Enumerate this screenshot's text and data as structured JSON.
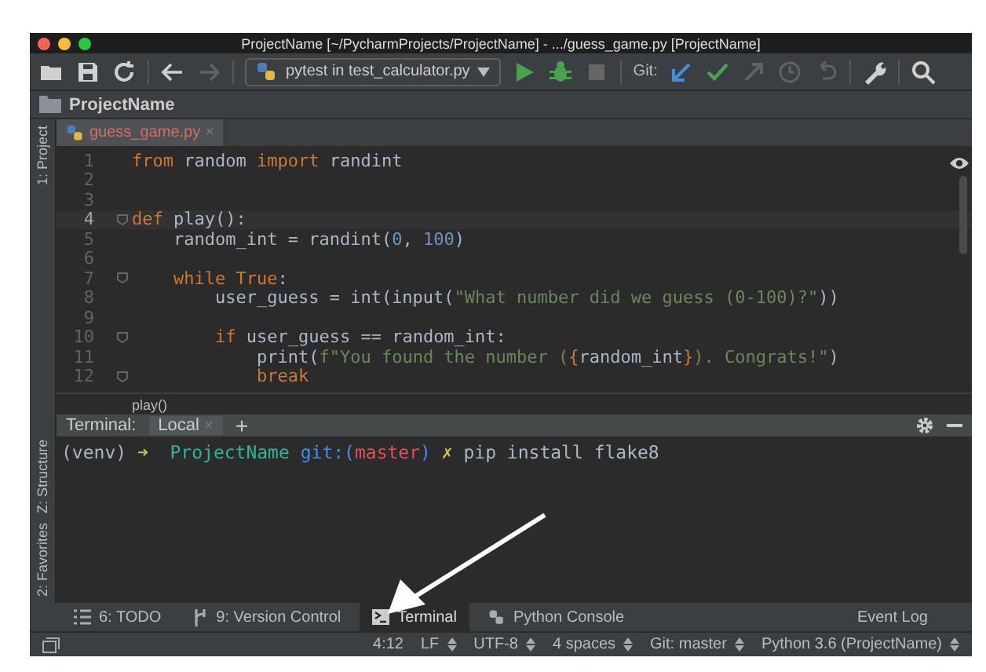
{
  "window": {
    "title": "ProjectName [~/PycharmProjects/ProjectName] - .../guess_game.py [ProjectName]"
  },
  "toolbar": {
    "icons": [
      {
        "disabled": false
      },
      {
        "disabled": false
      },
      {
        "disabled": false
      },
      {
        "disabled": false
      },
      {
        "disabled": true
      }
    ],
    "run_config": "pytest in test_calculator.py",
    "run_icons": [
      {
        "disabled": false
      },
      {
        "disabled": false
      },
      {
        "disabled": true
      }
    ],
    "git_label": "Git:",
    "git_icons": [
      {
        "disabled": false
      },
      {
        "disabled": false
      },
      {
        "disabled": true
      },
      {
        "disabled": true
      },
      {
        "disabled": true
      }
    ]
  },
  "navigation_bar": {
    "project": "ProjectName"
  },
  "left_stripe": [
    "1: Project",
    "Z: Structure",
    "2: Favorites"
  ],
  "editor_tabs": [
    {
      "label": "guess_game.py",
      "selected": true,
      "close": "×"
    }
  ],
  "code_lines": [
    {
      "number": "1",
      "fold": false,
      "current": false,
      "tokens": [
        {
          "kind": "keyword",
          "text": "from"
        },
        {
          "kind": "plain",
          "text": " random "
        },
        {
          "kind": "keyword",
          "text": "import"
        },
        {
          "kind": "plain",
          "text": " randint"
        }
      ]
    },
    {
      "number": "2",
      "fold": false,
      "current": false
    },
    {
      "number": "3",
      "fold": false,
      "current": false
    },
    {
      "number": "4",
      "fold": true,
      "current": true,
      "tokens": [
        {
          "kind": "keyword",
          "text": "def"
        },
        {
          "kind": "plain",
          "text": " play():"
        }
      ]
    },
    {
      "number": "5",
      "fold": false,
      "current": false,
      "tokens": [
        {
          "kind": "plain",
          "text": "    random_int = randint("
        },
        {
          "kind": "number",
          "text": "0"
        },
        {
          "kind": "plain",
          "text": ", "
        },
        {
          "kind": "number",
          "text": "100"
        },
        {
          "kind": "plain",
          "text": ")"
        }
      ]
    },
    {
      "number": "6",
      "fold": false,
      "current": false
    },
    {
      "number": "7",
      "fold": true,
      "current": false,
      "tokens": [
        {
          "kind": "keyword",
          "text": "    while True"
        },
        {
          "kind": "plain",
          "text": ":"
        }
      ]
    },
    {
      "number": "8",
      "fold": false,
      "current": false,
      "tokens": [
        {
          "kind": "plain",
          "text": "        user_guess = int(input("
        },
        {
          "kind": "string",
          "text": "\"What number did we guess (0-100)?\""
        },
        {
          "kind": "plain",
          "text": "))"
        }
      ]
    },
    {
      "number": "9",
      "fold": false,
      "current": false
    },
    {
      "number": "10",
      "fold": true,
      "current": false,
      "tokens": [
        {
          "kind": "keyword",
          "text": "        if"
        },
        {
          "kind": "plain",
          "text": " user_guess == random_int:"
        }
      ]
    },
    {
      "number": "11",
      "fold": false,
      "current": false,
      "tokens": [
        {
          "kind": "plain",
          "text": "            print("
        },
        {
          "kind": "string",
          "text": "f\"You found the number ("
        },
        {
          "kind": "keyword",
          "text": "{"
        },
        {
          "kind": "plain",
          "text": "random_int"
        },
        {
          "kind": "keyword",
          "text": "}"
        },
        {
          "kind": "string",
          "text": "). Congrats!\""
        },
        {
          "kind": "plain",
          "text": ")"
        }
      ]
    },
    {
      "number": "12",
      "fold": true,
      "current": false,
      "tokens": [
        {
          "kind": "keyword",
          "text": "            break"
        }
      ]
    }
  ],
  "breadcrumb": "play()",
  "terminal": {
    "label": "Terminal:",
    "tabs": [
      {
        "label": "Local",
        "selected": true,
        "close": "×"
      }
    ],
    "add": "+",
    "prompt": [
      {
        "kind": "plain",
        "text": "(venv) "
      },
      {
        "kind": "arrow",
        "text": "➜  "
      },
      {
        "kind": "project",
        "text": "ProjectName"
      },
      {
        "kind": "git",
        "text": " git:("
      },
      {
        "kind": "branch",
        "text": "master"
      },
      {
        "kind": "git",
        "text": ") "
      },
      {
        "kind": "dirty",
        "text": "✗"
      },
      {
        "kind": "plain",
        "text": " pip install flake8"
      }
    ]
  },
  "tool_windows": [
    {
      "label": "6: TODO",
      "kind": "list",
      "selected": false
    },
    {
      "label": "9: Version Control",
      "kind": "vcs",
      "selected": false
    },
    {
      "label": "Terminal",
      "kind": "terminal",
      "selected": true
    },
    {
      "label": "Python Console",
      "kind": "python",
      "selected": false
    }
  ],
  "event_log": "Event Log",
  "status_bar": [
    {
      "text": "4:12",
      "dropdown": false
    },
    {
      "text": "LF",
      "dropdown": true
    },
    {
      "text": "UTF-8",
      "dropdown": true
    },
    {
      "text": "4 spaces",
      "dropdown": true
    },
    {
      "text": "Git: master",
      "dropdown": true
    },
    {
      "text": "Python 3.6 (ProjectName)",
      "dropdown": true
    }
  ]
}
